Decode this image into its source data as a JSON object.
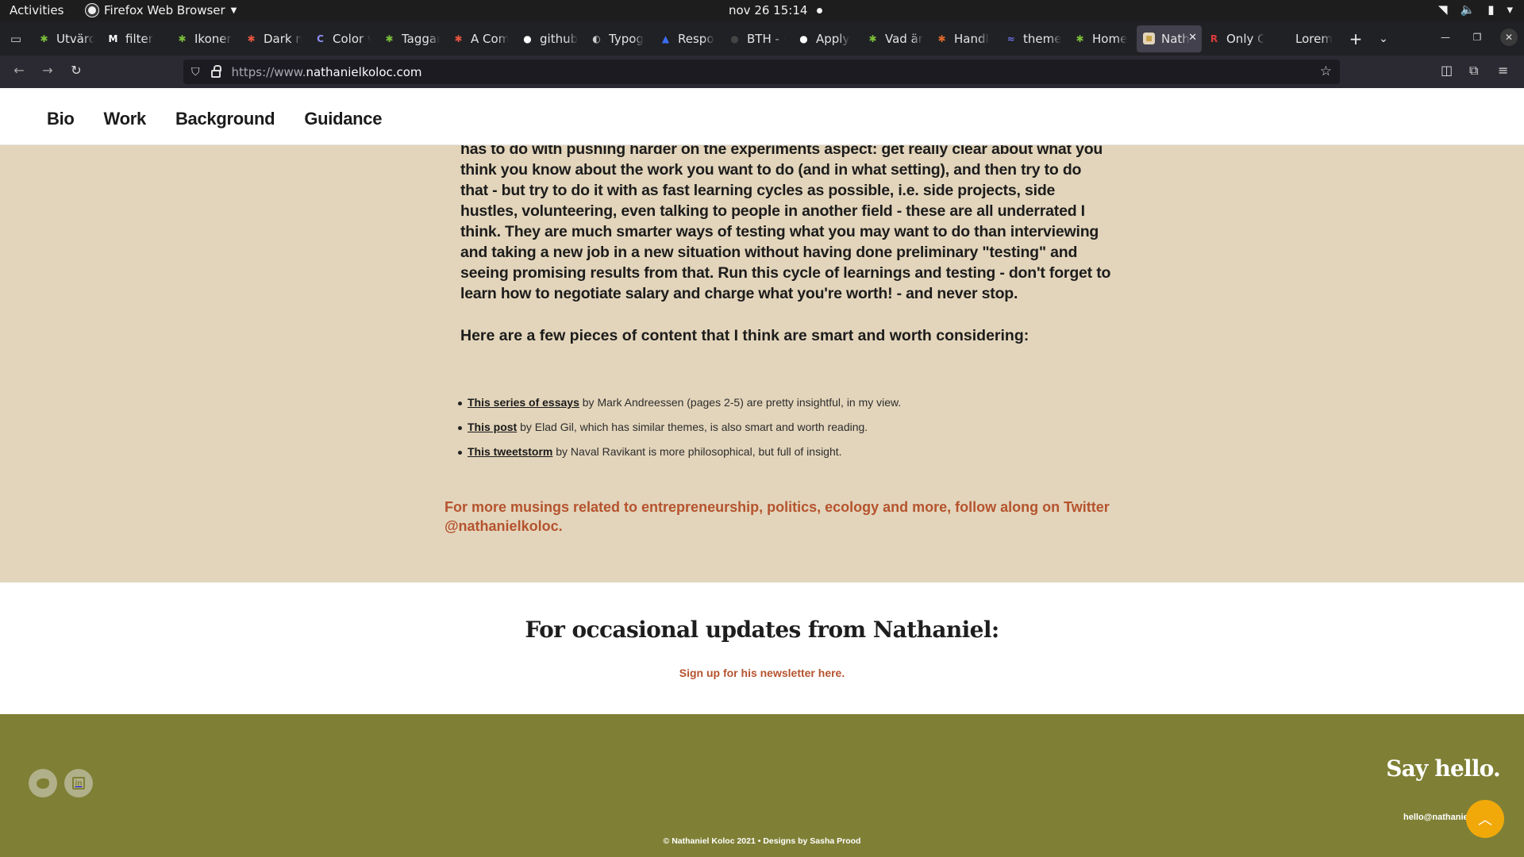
{
  "system_bar": {
    "activities": "Activities",
    "app_name": "Firefox Web Browser",
    "clock": "nov 26  15:14"
  },
  "browser": {
    "tabs": [
      {
        "title": "Utvärd",
        "fav": "✱",
        "fav_color": "#7bbf3a"
      },
      {
        "title": "filter",
        "fav": "M",
        "fav_color": "#ffffff"
      },
      {
        "title": "Ikoner",
        "fav": "✱",
        "fav_color": "#7bbf3a"
      },
      {
        "title": "Dark m",
        "fav": "✱",
        "fav_color": "#e8563f"
      },
      {
        "title": "Color v",
        "fav": "C",
        "fav_color": "#8f8ff0"
      },
      {
        "title": "Taggar",
        "fav": "✱",
        "fav_color": "#7bbf3a"
      },
      {
        "title": "A Com",
        "fav": "✱",
        "fav_color": "#e8563f"
      },
      {
        "title": "github",
        "fav": "●",
        "fav_color": "#ffffff"
      },
      {
        "title": "Typog",
        "fav": "◐",
        "fav_color": "#cccccc"
      },
      {
        "title": "Respo",
        "fav": "▲",
        "fav_color": "#3b6ef5"
      },
      {
        "title": "BTH - (",
        "fav": "●",
        "fav_color": "#444444"
      },
      {
        "title": "Apply",
        "fav": "●",
        "fav_color": "#ffffff"
      },
      {
        "title": "Vad är",
        "fav": "✱",
        "fav_color": "#7bbf3a"
      },
      {
        "title": "Handl",
        "fav": "✱",
        "fav_color": "#e06a2c"
      },
      {
        "title": "theme",
        "fav": "≈",
        "fav_color": "#6f6fe8"
      },
      {
        "title": "Home",
        "fav": "✱",
        "fav_color": "#7bbf3a"
      },
      {
        "title": "Nath",
        "fav": "■",
        "fav_color": "#e3d5bb",
        "active": true
      },
      {
        "title": "Only C",
        "fav": "R",
        "fav_color": "#d93b3b"
      },
      {
        "title": "Lorem",
        "fav": "",
        "fav_color": "#202124"
      }
    ],
    "url_protocol": "https://www.",
    "url_host": "nathanielkoloc.com"
  },
  "site_nav": {
    "items": [
      "Bio",
      "Work",
      "Background",
      "Guidance"
    ]
  },
  "content": {
    "paragraph": "has to do with pushing harder on the experiments aspect: get really clear about what you think you know about the work you want to do (and in what setting), and then try to do that - but try to do it with as fast learning cycles as possible, i.e. side projects, side hustles, volunteering, even talking to people in another field - these are all underrated I think. They are much smarter ways of testing what you may want to do than interviewing and taking a new job in a new situation without having done preliminary \"testing\" and seeing promising results from that. Run this cycle of learnings and testing - don't forget to learn how to negotiate salary and charge what you're worth! - and never stop.",
    "lead": "Here are a few pieces of content that I think are smart and worth considering:",
    "links": [
      {
        "link": "This series of essays",
        "rest": " by Mark Andreessen (pages 2-5) are pretty insightful, in my view."
      },
      {
        "link": "This post",
        "rest": " by Elad Gil, which has similar themes, is also smart and worth reading."
      },
      {
        "link": "This tweetstorm",
        "rest": " by Naval Ravikant is more philosophical, but full of insight."
      }
    ],
    "follow": "For more musings related to entrepreneurship, politics, ecology and more, follow along on Twitter @nathanielkoloc."
  },
  "updates": {
    "heading": "For occasional updates from Nathaniel:",
    "signup": "Sign up for his newsletter here."
  },
  "footer": {
    "say_hello": "Say hello.",
    "email": "hello@nathanielkoloc.com",
    "copyright": "© Nathaniel Koloc 2021 •  Designs by Sasha Prood"
  },
  "colors": {
    "accent": "#b5532e",
    "content_bg": "#e3d5bb",
    "footer_bg": "#7f8035",
    "scroll_top": "#f1a90a"
  }
}
